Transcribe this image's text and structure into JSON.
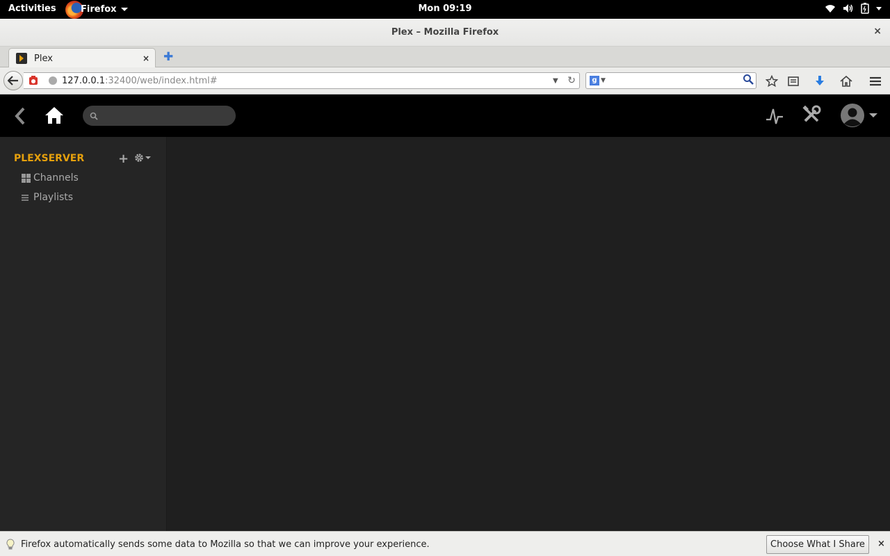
{
  "system": {
    "activities_label": "Activities",
    "app_name": "Firefox",
    "clock": "Mon 09:19"
  },
  "window": {
    "title": "Plex – Mozilla Firefox",
    "close_glyph": "×"
  },
  "tabs": [
    {
      "label": "Plex",
      "close_glyph": "×"
    }
  ],
  "new_tab_glyph": "✚",
  "navbar": {
    "url_host": "127.0.0.1",
    "url_rest": ":32400/web/index.html#",
    "search_placeholder": "",
    "search_engine_letter": "g"
  },
  "plex": {
    "search_placeholder": "",
    "server_name": "PLEXSERVER",
    "add_glyph": "+",
    "sidebar_items": [
      {
        "label": "Channels",
        "icon": "grid-icon"
      },
      {
        "label": "Playlists",
        "icon": "list-icon"
      }
    ],
    "accent_color": "#e5a00d"
  },
  "notification": {
    "message": "Firefox automatically sends some data to Mozilla so that we can improve your experience.",
    "button_label": "Choose What I Share",
    "close_glyph": "×"
  }
}
